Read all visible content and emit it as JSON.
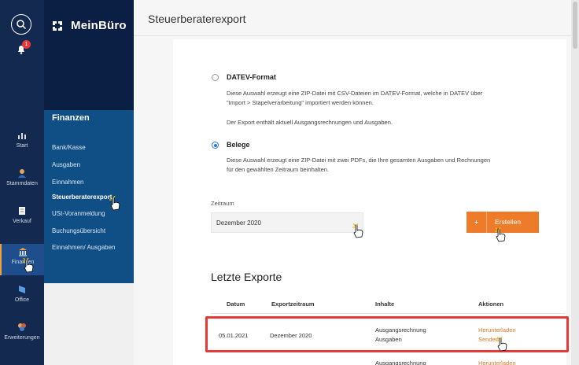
{
  "app": {
    "brand": "MeinBüro"
  },
  "rail": {
    "notifications_badge": "1",
    "items": [
      {
        "label": "Start"
      },
      {
        "label": "Stammdaten"
      },
      {
        "label": "Verkauf"
      },
      {
        "label": "Finanzen"
      },
      {
        "label": "Office"
      },
      {
        "label": "Erweiterungen"
      }
    ]
  },
  "nav": {
    "section": "Finanzen",
    "items": [
      {
        "label": "Bank/Kasse"
      },
      {
        "label": "Ausgaben"
      },
      {
        "label": "Einnahmen"
      },
      {
        "label": "Steuerberaterexport"
      },
      {
        "label": "USt-Voranmeldung"
      },
      {
        "label": "Buchungsübersicht"
      },
      {
        "label": "Einnahmen/ Ausgaben"
      }
    ]
  },
  "page": {
    "title": "Steuerberaterexport"
  },
  "options": {
    "datev": {
      "title": "DATEV-Format",
      "line1": "Diese Auswahl erzeugt eine ZIP-Datei mit CSV-Dateien im DATEV-Format, welche in DATEV über",
      "line2": "\"Import > Stapelverarbeitung\" importiert werden können.",
      "line3": "Der Export enthält aktuell Ausgangsrechnungen und Ausgaben."
    },
    "belege": {
      "title": "Belege",
      "line1": "Diese Auswahl erzeugt eine ZIP-Datei mit zwei PDFs, die Ihre gesamten Ausgaben und Rechnungen",
      "line2": "für den gewählten Zeitraum beinhalten."
    }
  },
  "period": {
    "label": "Zeitraum",
    "value": "Dezember 2020"
  },
  "create_button": {
    "icon": "+",
    "label": "Erstellen"
  },
  "exports": {
    "title": "Letzte Exporte",
    "columns": [
      "Datum",
      "Exportzeitraum",
      "Inhalte",
      "Aktionen"
    ],
    "rows": [
      {
        "date": "05.01.2021",
        "period": "Dezember 2020",
        "content1": "Ausgangsrechnung",
        "content2": "Ausgaben",
        "action1": "Herunterladen",
        "action2": "Senden"
      },
      {
        "content1": "Ausgangsrechnung",
        "action1": "Herunterladen"
      }
    ]
  },
  "colors": {
    "accent": "#ee7b2a",
    "nav_dark": "#0b1f45",
    "nav_blue": "#0f4f85",
    "highlight": "#e53935"
  }
}
